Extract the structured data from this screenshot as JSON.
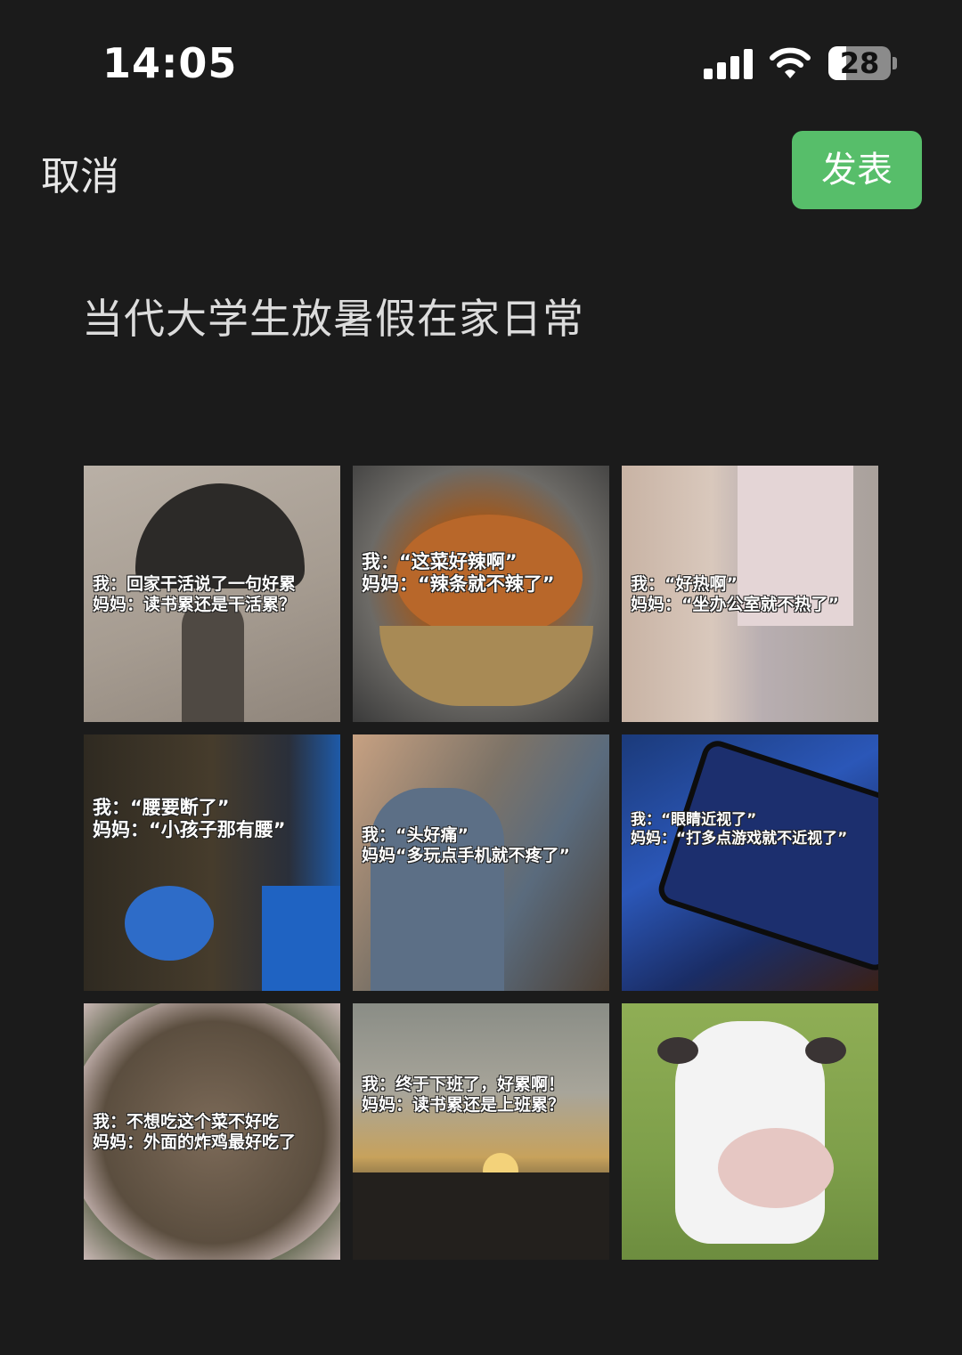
{
  "status_bar": {
    "time": "14:05",
    "battery_percent": "28",
    "battery_level": 0.28
  },
  "nav": {
    "cancel_label": "取消",
    "publish_label": "发表",
    "publish_color": "#57be6a"
  },
  "post": {
    "text": "当代大学生放暑假在家日常"
  },
  "photos": [
    {
      "line1": "我：回家干活说了一句好累",
      "line2": "妈妈：读书累还是干活累？"
    },
    {
      "line1": "我：“这菜好辣啊”",
      "line2": "妈妈：“辣条就不辣了”"
    },
    {
      "line1": "我：“好热啊”",
      "line2": "妈妈：“坐办公室就不热了”"
    },
    {
      "line1": "我：“腰要断了”",
      "line2": "妈妈：“小孩子那有腰”"
    },
    {
      "line1": "我：“头好痛”",
      "line2": "妈妈“多玩点手机就不疼了”"
    },
    {
      "line1": "我：“眼睛近视了”",
      "line2": "妈妈：“打多点游戏就不近视了”"
    },
    {
      "line1": "我：不想吃这个菜不好吃",
      "line2": "妈妈：外面的炸鸡最好吃了"
    },
    {
      "line1": "我：终于下班了，好累啊！",
      "line2": "妈妈：读书累还是上班累？"
    },
    {
      "line1": "",
      "line2": ""
    }
  ]
}
